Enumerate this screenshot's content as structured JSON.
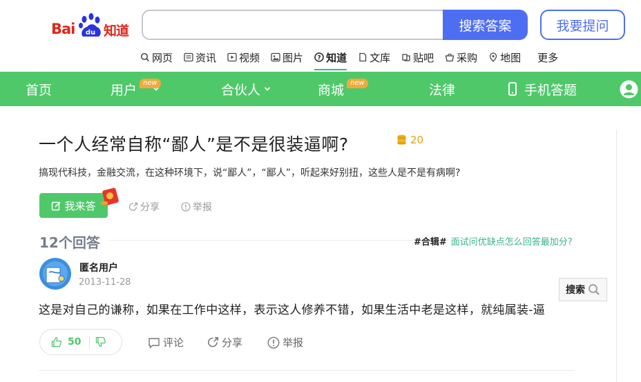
{
  "header": {
    "logo_text_bai": "Bai",
    "logo_text_du": "du",
    "logo_text_zhidao": "知道",
    "search_placeholder": "",
    "search_button": "搜索答案",
    "ask_button": "我要提问"
  },
  "tabs": [
    {
      "label": "网页",
      "icon": "search-icon"
    },
    {
      "label": "资讯",
      "icon": "news-icon"
    },
    {
      "label": "视频",
      "icon": "video-icon"
    },
    {
      "label": "图片",
      "icon": "image-icon"
    },
    {
      "label": "知道",
      "icon": "question-icon",
      "active": true
    },
    {
      "label": "文库",
      "icon": "document-icon"
    },
    {
      "label": "贴吧",
      "icon": "tieba-icon"
    },
    {
      "label": "采购",
      "icon": "basket-icon"
    },
    {
      "label": "地图",
      "icon": "map-icon"
    },
    {
      "label": "更多",
      "icon": ""
    }
  ],
  "nav": {
    "home": "首页",
    "user": "用户",
    "partner": "合伙人",
    "mall": "商城",
    "law": "法律",
    "mobile": "手机答题",
    "new_badge": "new"
  },
  "question": {
    "title": "一个人经常自称“鄙人”是不是很装逼啊?",
    "reward": "20",
    "description": "搞现代科技，金融交流，在这种环境下，说“鄙人”，“鄙人”，听起来好别扭，这些人是不是有病啊?",
    "answer_button": "我来答",
    "share": "分享",
    "report": "举报"
  },
  "answers_header": {
    "count": "12个回答",
    "topic_tag": "#合辑#",
    "topic_link": "面试问优缺点怎么回答最加分?"
  },
  "answer": {
    "username": "匿名用户",
    "date": "2013-11-28",
    "text": "这是对自己的谦称，如果在工作中这样，表示这人修养不错，如果生活中老是这样，就纯属装-逼",
    "likes": "50",
    "comment": "评论",
    "share": "分享",
    "report": "举报"
  },
  "float_search": "搜索",
  "colors": {
    "brand_blue": "#4e6ef2",
    "nav_green": "#4fc86a",
    "link_green": "#38b48b",
    "reward_gold": "#e5a10a",
    "logo_red": "#e1251b"
  }
}
